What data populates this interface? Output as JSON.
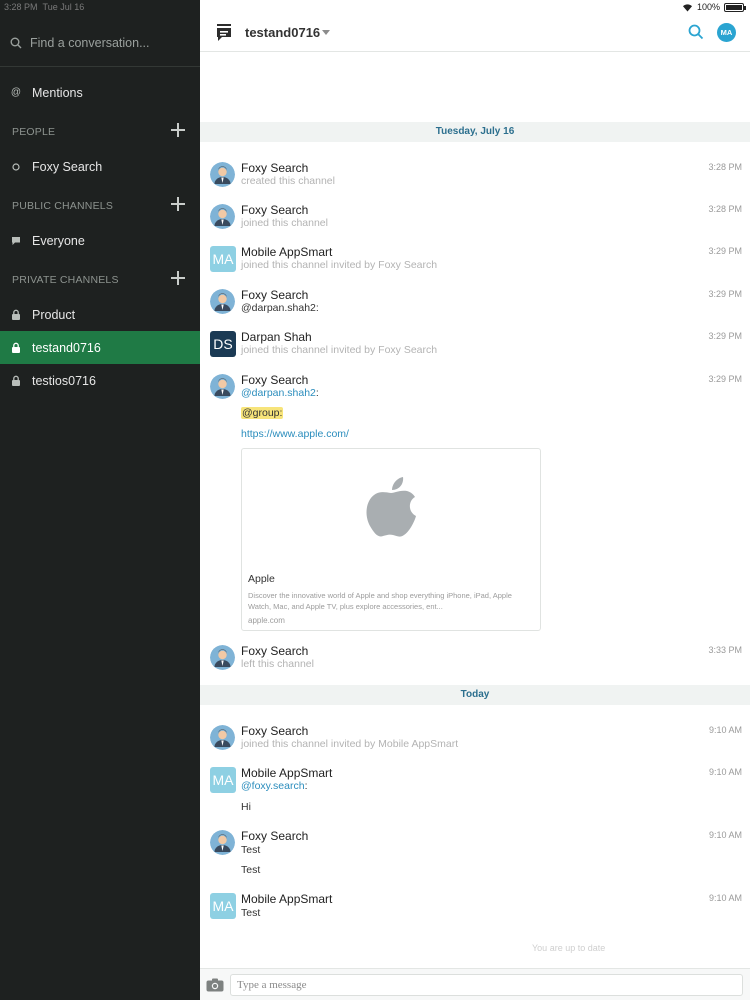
{
  "status_bar": {
    "time": "3:28 PM",
    "date": "Tue Jul 16",
    "battery_text": "100%",
    "battery_level": 1.0
  },
  "sidebar": {
    "search_placeholder": "Find a conversation...",
    "mentions_label": "Mentions",
    "sections": {
      "people": "PEOPLE",
      "public": "PUBLIC CHANNELS",
      "private": "PRIVATE CHANNELS"
    },
    "people": [
      {
        "label": "Foxy Search"
      }
    ],
    "public_channels": [
      {
        "label": "Everyone"
      }
    ],
    "private_channels": [
      {
        "label": "Product",
        "active": false
      },
      {
        "label": "testand0716",
        "active": true
      },
      {
        "label": "testios0716",
        "active": false
      }
    ]
  },
  "header": {
    "channel": "testand0716",
    "avatar_initials": "MA"
  },
  "dates": {
    "first": "Tuesday, July 16",
    "second": "Today"
  },
  "messages": [
    {
      "sender": "Foxy Search",
      "time": "3:28 PM",
      "text": "created this channel"
    },
    {
      "sender": "Foxy Search",
      "time": "3:28 PM",
      "text": "joined this channel"
    },
    {
      "sender": "Mobile AppSmart",
      "avatar": "MA",
      "time": "3:29 PM",
      "text": "joined this channel invited by Foxy Search"
    },
    {
      "sender": "Foxy Search",
      "time": "3:29 PM",
      "text": "@darpan.shah2:"
    },
    {
      "sender": "Darpan Shah",
      "avatar": "DS",
      "time": "3:29 PM",
      "text": "joined this channel invited by Foxy Search"
    },
    {
      "sender": "Foxy Search",
      "time": "3:29 PM",
      "mention": "@darpan.shah2",
      "mention_suffix": ":",
      "tag": "@group:",
      "link": "https://www.apple.com/",
      "preview": {
        "title": "Apple",
        "description": "Discover the innovative world of Apple and shop everything iPhone, iPad, Apple Watch, Mac, and Apple TV, plus explore accessories, ent...",
        "domain": "apple.com"
      }
    },
    {
      "sender": "Foxy Search",
      "time": "3:33 PM",
      "text": "left this channel"
    },
    {
      "sender": "Foxy Search",
      "time": "9:10 AM",
      "text": "joined this channel invited by Mobile AppSmart"
    },
    {
      "sender": "Mobile AppSmart",
      "avatar": "MA",
      "time": "9:10 AM",
      "mention": "@foxy.search",
      "mention_suffix": ":",
      "text2": "Hi"
    },
    {
      "sender": "Foxy Search",
      "time": "9:10 AM",
      "text": "Test",
      "text2": "Test"
    },
    {
      "sender": "Mobile AppSmart",
      "avatar": "MA",
      "time": "9:10 AM",
      "text": "Test"
    }
  ],
  "up_to_date": "You are up to date",
  "composer": {
    "placeholder": "Type a message"
  },
  "colors": {
    "sidebar_bg": "#1e2120",
    "active_channel": "#1f7a45",
    "link": "#2b8dbd",
    "highlight": "#f7e47a",
    "date_text": "#2c6f8e"
  }
}
